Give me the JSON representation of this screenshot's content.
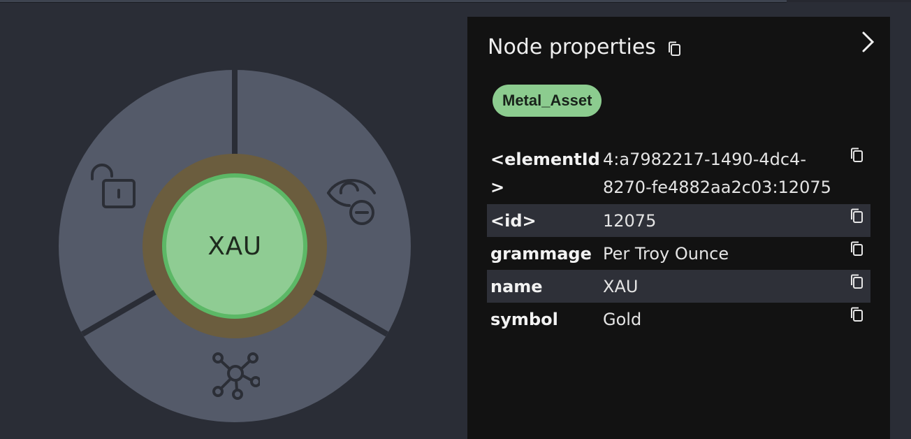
{
  "radial_menu": {
    "node_caption": "XAU",
    "actions": [
      {
        "name": "unlock",
        "icon": "unlock-icon"
      },
      {
        "name": "hide",
        "icon": "eye-minus-icon"
      },
      {
        "name": "expand",
        "icon": "graph-expand-icon"
      }
    ],
    "colors": {
      "segment": "#545a69",
      "ring": "#6b5d3e",
      "node_fill": "#8fcc93",
      "node_border": "#5cb866"
    }
  },
  "panel": {
    "title": "Node properties",
    "label_chip": "Metal_Asset",
    "properties": [
      {
        "key": "<elementId>",
        "value": "4:a7982217-1490-4dc4-8270-fe4882aa2c03:12075"
      },
      {
        "key": "<id>",
        "value": "12075"
      },
      {
        "key": "grammage",
        "value": "Per Troy Ounce"
      },
      {
        "key": "name",
        "value": "XAU"
      },
      {
        "key": "symbol",
        "value": "Gold"
      }
    ],
    "icons": {
      "copy": "copy-icon",
      "collapse": "chevron-right-icon"
    }
  }
}
